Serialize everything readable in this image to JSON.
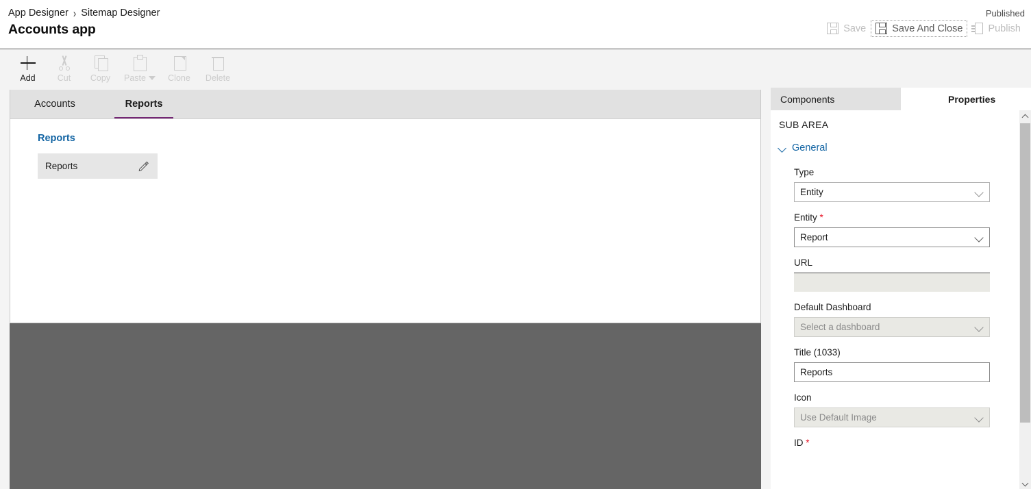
{
  "header": {
    "breadcrumb": [
      {
        "label": "App Designer",
        "icon": ""
      },
      {
        "label": "Sitemap Designer",
        "icon": ""
      }
    ],
    "breadcrumb_separator": "›",
    "app_title": "Accounts app",
    "status": "Published",
    "actions": [
      {
        "label": "Save",
        "icon": "save-floppy-icon",
        "enabled": false,
        "focused": false
      },
      {
        "label": "Save And Close",
        "icon": "save-and-close-icon",
        "enabled": false,
        "focused": true
      },
      {
        "label": "Publish",
        "icon": "publish-page-icon",
        "enabled": false,
        "focused": false
      }
    ]
  },
  "toolbar": {
    "items": [
      {
        "label": "Add",
        "icon": "plus-icon",
        "enabled": true,
        "dropdown": false
      },
      {
        "label": "Cut",
        "icon": "scissors-icon",
        "enabled": false,
        "dropdown": false
      },
      {
        "label": "Copy",
        "icon": "copy-icon",
        "enabled": false,
        "dropdown": false
      },
      {
        "label": "Paste",
        "icon": "clipboard-icon",
        "enabled": false,
        "dropdown": true
      },
      {
        "label": "Clone",
        "icon": "clone-page-icon",
        "enabled": false,
        "dropdown": false
      },
      {
        "label": "Delete",
        "icon": "trash-icon",
        "enabled": false,
        "dropdown": false
      }
    ]
  },
  "canvas": {
    "tabs": [
      {
        "label": "Accounts",
        "active": false
      },
      {
        "label": "Reports",
        "active": true
      }
    ],
    "group_title": "Reports",
    "subarea": {
      "label": "Reports",
      "edit_icon": "pencil-icon"
    },
    "accent_color": "#742774",
    "link_color": "#1264a3",
    "overlay_color": "#656565"
  },
  "panel": {
    "tabs": [
      {
        "label": "Components",
        "active": false
      },
      {
        "label": "Properties",
        "active": true
      }
    ],
    "heading": "SUB AREA",
    "section": {
      "label": "General",
      "expanded": true
    },
    "fields": [
      {
        "name": "type",
        "label": "Type",
        "value": "Entity",
        "control": "dropdown",
        "required": false,
        "disabled": false,
        "placeholder": ""
      },
      {
        "name": "entity",
        "label": "Entity",
        "value": "Report",
        "control": "dropdown",
        "required": true,
        "disabled": false,
        "placeholder": ""
      },
      {
        "name": "url",
        "label": "URL",
        "value": "",
        "control": "text",
        "required": false,
        "disabled": true,
        "placeholder": ""
      },
      {
        "name": "default_dashboard",
        "label": "Default Dashboard",
        "value": "Select a dashboard",
        "control": "dropdown",
        "required": false,
        "disabled": true,
        "placeholder": "Select a dashboard"
      },
      {
        "name": "title",
        "label": "Title (1033)",
        "value": "Reports",
        "control": "text",
        "required": false,
        "disabled": false,
        "placeholder": ""
      },
      {
        "name": "icon",
        "label": "Icon",
        "value": "Use Default Image",
        "control": "dropdown",
        "required": false,
        "disabled": true,
        "placeholder": "Use Default Image"
      },
      {
        "name": "id",
        "label": "ID",
        "value": "",
        "control": "text",
        "required": true,
        "disabled": false,
        "placeholder": ""
      }
    ],
    "required_marker": "*"
  }
}
